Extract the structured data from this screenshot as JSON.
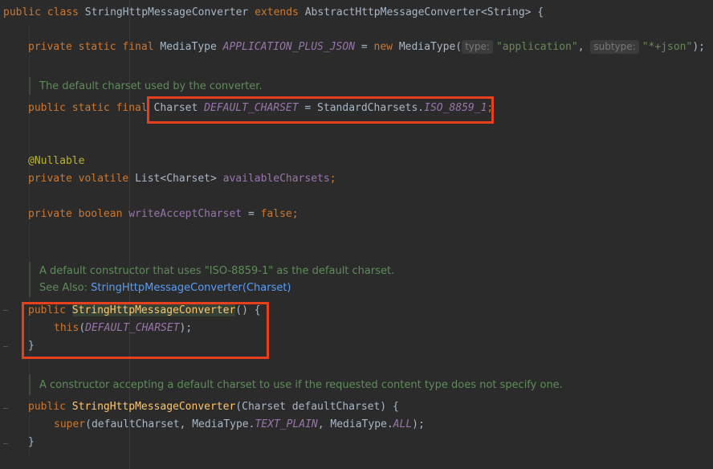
{
  "editor": {
    "class_decl": {
      "kw_public": "public",
      "kw_class": "class",
      "name": "StringHttpMessageConverter",
      "kw_extends": "extends",
      "parent": "AbstractHttpMessageConverter<String>",
      "brace": " {"
    },
    "field_json": {
      "mods": "private static final",
      "type": "MediaType",
      "name": "APPLICATION_PLUS_JSON",
      "eq": " = ",
      "kw_new": "new",
      "ctor": " MediaType(",
      "hint_type": "type:",
      "arg1": "\"application\"",
      "comma": ",",
      "hint_subtype": "subtype:",
      "arg2": "\"*+json\"",
      "end": ");"
    },
    "doc_default_charset": "The default charset used by the converter.",
    "field_charset": {
      "mods": "public static final",
      "type": "Charset",
      "name": "DEFAULT_CHARSET",
      "eq": " = StandardCharsets.",
      "value": "ISO_8859_1",
      "end": ";"
    },
    "nullable": "@Nullable",
    "field_available": {
      "mods": "private volatile",
      "type": "List<Charset>",
      "name": "availableCharsets",
      "end": ";"
    },
    "field_write": {
      "mods": "private boolean",
      "name": "writeAcceptCharset",
      "eq": " = ",
      "value": "false",
      "end": ";"
    },
    "doc_ctor1": {
      "text1": "A default constructor that uses \"ISO-8859-1\" as the default charset.",
      "see_label": "See Also: ",
      "see_link": "StringHttpMessageConverter(Charset)"
    },
    "ctor1": {
      "kw_public": "public",
      "name": "StringHttpMessageConverter",
      "sig": "() {",
      "body_kw": "this",
      "body_arg": "DEFAULT_CHARSET",
      "body_end": ");",
      "close": "}"
    },
    "doc_ctor2": "A constructor accepting a default charset to use if the requested content type does not specify one.",
    "ctor2": {
      "kw_public": "public",
      "name": "StringHttpMessageConverter",
      "sig": "(Charset defaultCharset) {",
      "body_kw": "super",
      "body_a": "(defaultCharset, MediaType.",
      "body_c1": "TEXT_PLAIN",
      "body_b": ", MediaType.",
      "body_c2": "ALL",
      "body_end": ");",
      "close": "}"
    }
  }
}
